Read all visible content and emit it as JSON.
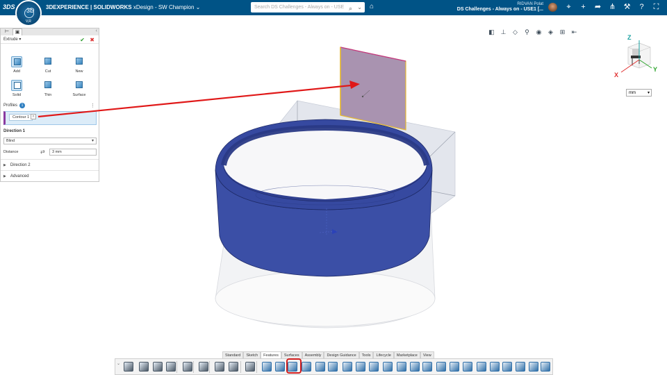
{
  "topbar": {
    "ds_logo": "3DS",
    "brand_strong": "3DEXPERIENCE | SOLIDWORKS",
    "brand_rest": " xDesign - SW Champion",
    "search_placeholder": "Search DS Challenges - Always on - USE",
    "compass_version": "V,R",
    "compass_top": "3D",
    "user_name": "RIDVAN Polat",
    "user_context": "DS Challenges - Always on - USE1 [..."
  },
  "panel": {
    "title": "Extrude",
    "options": [
      {
        "label": "Add",
        "icon": "extrude-add-icon"
      },
      {
        "label": "Cut",
        "icon": "extrude-cut-icon"
      },
      {
        "label": "New",
        "icon": "new-body-icon"
      },
      {
        "label": "Solid",
        "icon": "solid-icon"
      },
      {
        "label": "Thin",
        "icon": "thin-icon"
      },
      {
        "label": "Surface",
        "icon": "surface-icon"
      }
    ],
    "profiles_label": "Profiles",
    "profiles_count": "1",
    "profile_chip": "Contour 1",
    "direction1_title": "Direction 1",
    "direction1_type": "Blind",
    "distance_label": "Distance",
    "distance_value": "3 mm",
    "direction2_title": "Direction 2",
    "advanced_title": "Advanced"
  },
  "viewport": {
    "unit": "mm",
    "axis_x": "X",
    "axis_y": "Y",
    "axis_z": "Z"
  },
  "command_tabs": [
    "Standard",
    "Sketch",
    "Features",
    "Surfaces",
    "Assembly",
    "Design Guidance",
    "Tools",
    "Lifecycle",
    "Marketplace",
    "View"
  ],
  "active_tab": "Features",
  "colors": {
    "topbar": "#005386",
    "body_blue": "#3b4fa6",
    "sketch_face": "#a993b0",
    "arrow_red": "#e01818",
    "selected_highlight": "#d11d1d"
  }
}
